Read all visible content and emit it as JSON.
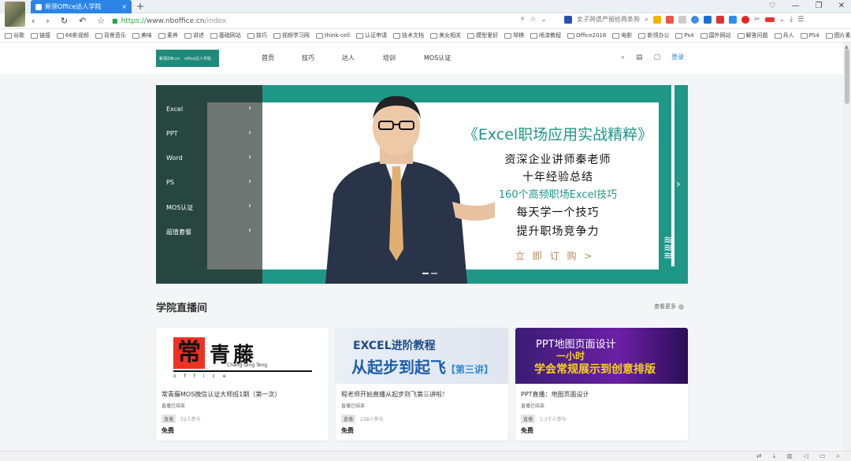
{
  "browser": {
    "tab_title": "新领Office达人学院",
    "tab_close": "×",
    "new_tab": "+",
    "window_controls": [
      "♡",
      "—",
      "❐",
      "✕"
    ],
    "url_protocol": "https://",
    "url_host": "www.nboffice.cn",
    "url_path": "/index",
    "search_suggestion": "女子跨遗产留给两条狗",
    "bookmarks": [
      "谷歌",
      "链接",
      "66影视频",
      "背景音乐",
      "美味",
      "素养",
      "讲述",
      "基础网站",
      "技巧",
      "视频学习网",
      "think-cell",
      "认证申请",
      "技术文档",
      "美女相关",
      "模型爱好",
      "琴棋",
      "喷漆教程",
      "Office2016",
      "电影",
      "新领办公",
      "Ps4",
      "国外网站",
      "解答问题",
      "兵人",
      "PS4",
      "图片素材"
    ],
    "bookmarks_more": "»"
  },
  "site": {
    "logo_text": "新领ZIN.cn",
    "logo_sub": "office达人学院",
    "nav": [
      "首页",
      "技巧",
      "达人",
      "培训",
      "MOS认证"
    ],
    "login": "登录"
  },
  "banner": {
    "menu": [
      "Excel",
      "PPT",
      "Word",
      "PS",
      "MOS认证",
      "超值套餐"
    ],
    "title": "《Excel职场应用实战精粹》",
    "lines": [
      "资深企业讲师秦老师",
      "十年经验总结",
      "160个高频职场Excel技巧",
      "每天学一个技巧",
      "提升职场竞争力"
    ],
    "buy": "立 即 订 购 >"
  },
  "live": {
    "section_title": "学院直播间",
    "more": "查看更多",
    "cards": [
      {
        "thumb_main": "常",
        "thumb_title": "青藤",
        "thumb_en": "Chang Qing Teng",
        "thumb_office": "office",
        "title": "常青藤MOS微信认证大师班1期（第一次）",
        "status": "直播已结束",
        "tag": "直播",
        "count": "52人参与",
        "price": "免费"
      },
      {
        "thumb_title": "EXCEL进阶教程",
        "thumb_sub": "从起步到起飞",
        "thumb_tag": "【第三讲】",
        "title": "程老师开始直播从起步到飞第三讲啦！",
        "status": "直播已结束",
        "tag": "直播",
        "count": "228人参与",
        "price": "免费"
      },
      {
        "thumb_title": "PPT地图页面设计",
        "thumb_sub": "一小时",
        "thumb_sub2": "学会常规展示到创意排版",
        "title": "PPT直播：地图页面设计",
        "status": "直播已结束",
        "tag": "直播",
        "count": "1.3千人参与",
        "price": "免费"
      }
    ]
  },
  "colors": {
    "brand_teal": "#1e9787",
    "tab_blue": "#2b84e6",
    "accent_gold": "#b38a5a"
  }
}
